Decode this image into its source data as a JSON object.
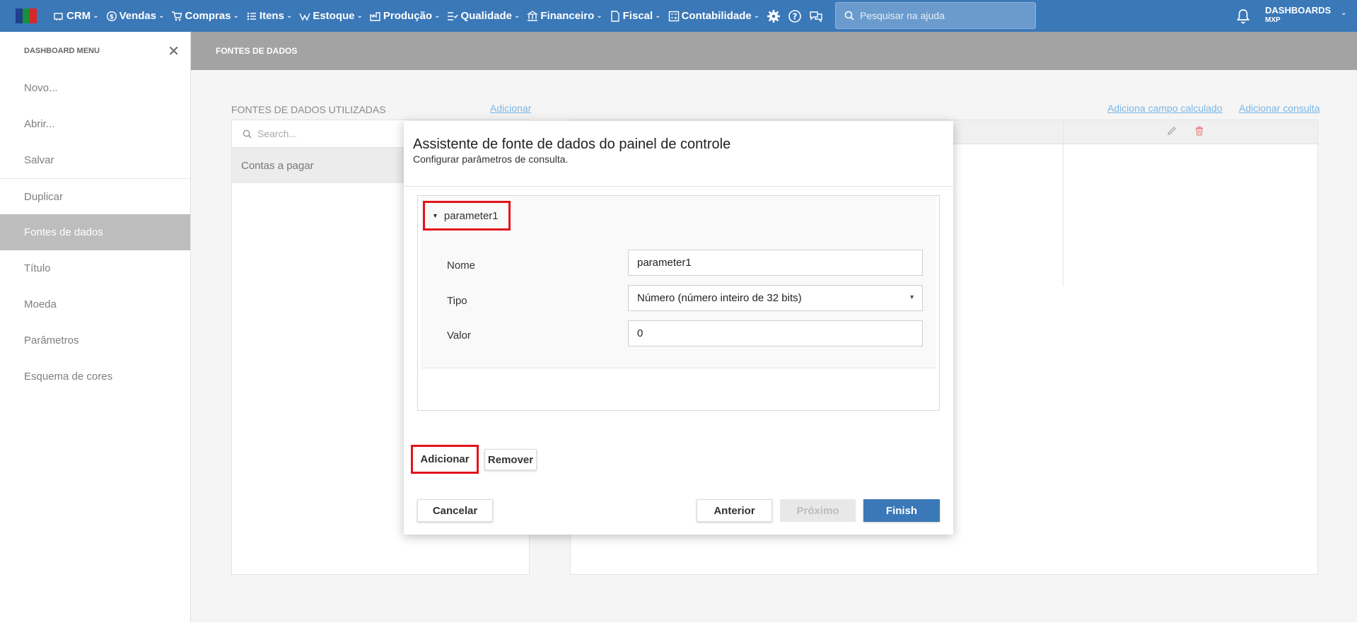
{
  "colors": {
    "topbar": "#3a78b8",
    "highlight": "#e3121b",
    "link": "#7ab6e6",
    "active_item": "#bdbdbd"
  },
  "topbar": {
    "nav": [
      {
        "label": "CRM",
        "icon": "crm-icon"
      },
      {
        "label": "Vendas",
        "icon": "dollar-icon"
      },
      {
        "label": "Compras",
        "icon": "cart-icon"
      },
      {
        "label": "Itens",
        "icon": "items-icon"
      },
      {
        "label": "Estoque",
        "icon": "stock-icon"
      },
      {
        "label": "Produção",
        "icon": "production-icon"
      },
      {
        "label": "Qualidade",
        "icon": "quality-icon"
      },
      {
        "label": "Financeiro",
        "icon": "finance-icon"
      },
      {
        "label": "Fiscal",
        "icon": "fiscal-icon"
      },
      {
        "label": "Contabilidade",
        "icon": "accounting-icon"
      }
    ],
    "search_placeholder": "Pesquisar na ajuda",
    "user": {
      "title": "DASHBOARDS",
      "subtitle": "MXP"
    }
  },
  "sidebar": {
    "title": "DASHBOARD MENU",
    "items": [
      {
        "label": "Novo..."
      },
      {
        "label": "Abrir..."
      },
      {
        "label": "Salvar"
      },
      {
        "label": "Duplicar"
      },
      {
        "label": "Fontes de dados",
        "active": true
      },
      {
        "label": "Título"
      },
      {
        "label": "Moeda"
      },
      {
        "label": "Parâmetros"
      },
      {
        "label": "Esquema de cores"
      }
    ]
  },
  "content": {
    "header": "FONTES DE DADOS",
    "datasources_title": "FONTES DE DADOS UTILIZADAS",
    "add_link": "Adicionar",
    "calc_field_link": "Adiciona campo calculado",
    "add_query_link": "Adicionar consulta",
    "search_placeholder": "Search...",
    "datasources": [
      "Contas a pagar"
    ]
  },
  "modal": {
    "title": "Assistente de fonte de dados do painel de controle",
    "subtitle": "Configurar parâmetros de consulta.",
    "parameter_name": "parameter1",
    "fields": {
      "nome_label": "Nome",
      "nome_value": "parameter1",
      "tipo_label": "Tipo",
      "tipo_value": "Número (número inteiro de 32 bits)",
      "valor_label": "Valor",
      "valor_value": "0"
    },
    "buttons": {
      "add": "Adicionar",
      "remove": "Remover",
      "cancel": "Cancelar",
      "previous": "Anterior",
      "next": "Próximo",
      "finish": "Finish"
    }
  }
}
